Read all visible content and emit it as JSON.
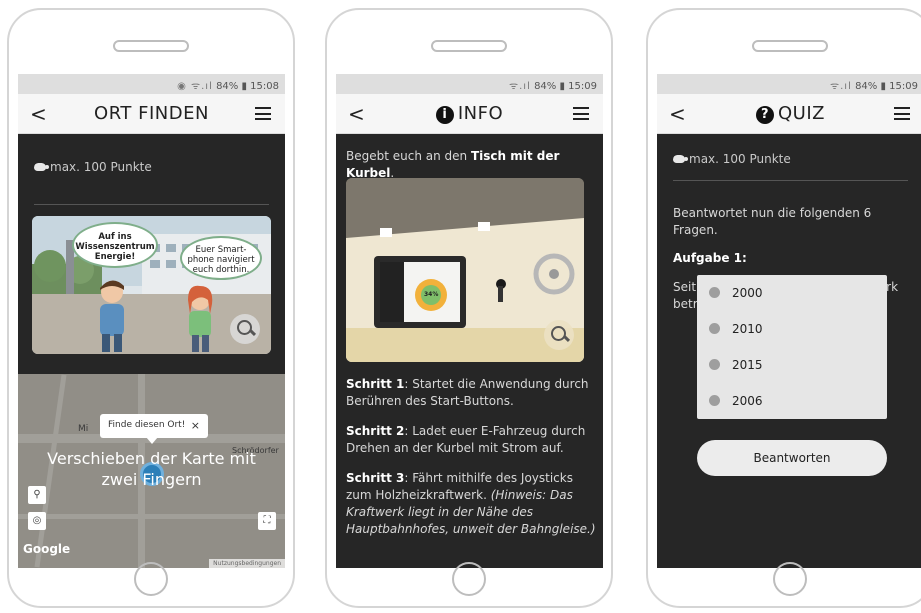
{
  "phones": [
    {
      "status": {
        "icons": "◉ ᯤ.ıl",
        "battery": "84% ▮",
        "time": "15:08"
      },
      "header": {
        "back": "<",
        "title": "ORT FINDEN"
      },
      "points": "max. 100 Punkte",
      "hero": {
        "bubble_left": [
          "Auf ins",
          "Wissenszentrum",
          "Energie!"
        ],
        "bubble_right": [
          "Euer Smart-",
          "phone navigiert",
          "euch dorthin."
        ]
      },
      "map": {
        "popup": "Finde diesen Ort!",
        "popup_close": "×",
        "gesture_hint": "Verschieben der Karte mit zwei Fingern",
        "google": "Google",
        "terms": "Nutzungsbedingungen",
        "street_labels": [
          "Mi",
          "Schrödorfer"
        ]
      }
    },
    {
      "status": {
        "icons": "ᯤ.ıl",
        "battery": "84% ▮",
        "time": "15:09"
      },
      "header": {
        "back": "<",
        "title": "INFO",
        "title_icon": "i"
      },
      "intro_prefix": "Begebt euch an den ",
      "intro_bold": "Tisch mit der Kurbel",
      "intro_suffix": ".",
      "photo": {
        "screen_label": "34%"
      },
      "steps": [
        {
          "label": "Schritt 1",
          "text": ": Startet die Anwendung durch Berühren des Start-Buttons."
        },
        {
          "label": "Schritt 2",
          "text": ": Ladet euer E-Fahrzeug durch Drehen an der Kurbel mit Strom auf."
        },
        {
          "label": "Schritt 3",
          "text": ": Fährt mithilfe des Joysticks zum Holzheizkraftwerk. ",
          "hint": "(Hinweis: Das Kraftwerk liegt in der Nähe des Hauptbahnhofes, unweit der Bahngleise.)"
        }
      ]
    },
    {
      "status": {
        "icons": "ᯤ.ıl",
        "battery": "84% ▮",
        "time": "15:09"
      },
      "header": {
        "back": "<",
        "title": "QUIZ",
        "title_icon": "?"
      },
      "points": "max. 100 Punkte",
      "instruction": "Beantwortet nun die folgenden 6 Fragen.",
      "task_label": "Aufgabe 1:",
      "question": "Seit wann wird das Holzheizkraftwerk betrieben?",
      "options": [
        "2000",
        "2010",
        "2015",
        "2006"
      ],
      "submit": "Beantworten"
    }
  ]
}
